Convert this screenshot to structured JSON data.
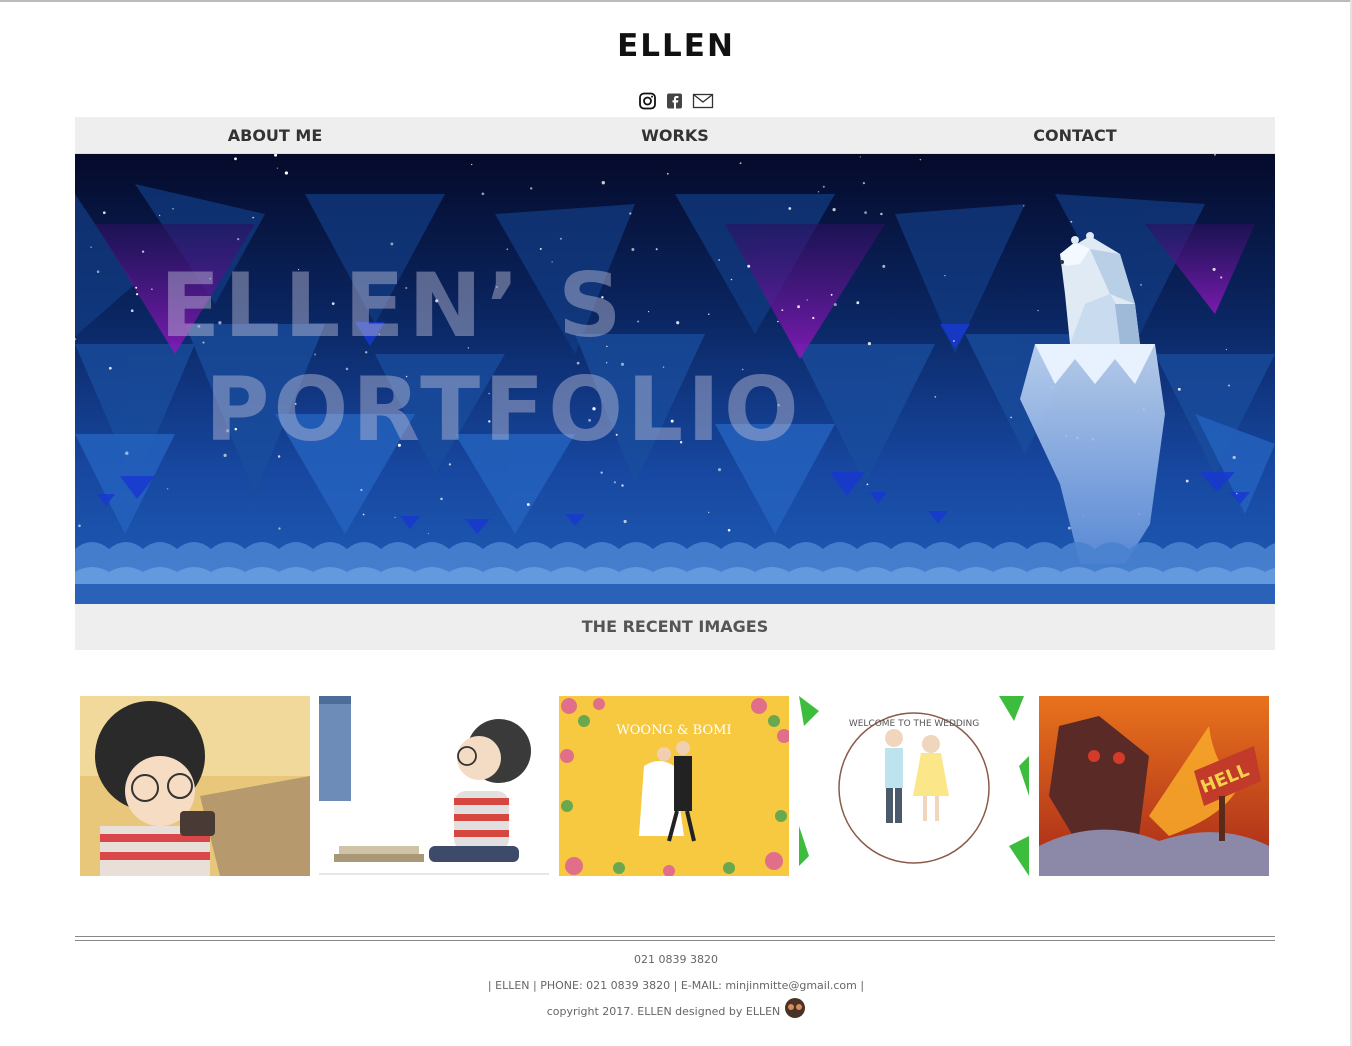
{
  "header": {
    "title": "ELLEN",
    "social_icons": [
      "instagram-icon",
      "facebook-icon",
      "mail-icon"
    ]
  },
  "nav": {
    "items": [
      {
        "label": "ABOUT ME"
      },
      {
        "label": "WORKS"
      },
      {
        "label": "CONTACT"
      }
    ]
  },
  "hero": {
    "line1": "ELLEN’ S",
    "line2": "PORTFOLIO"
  },
  "recent": {
    "title": "THE RECENT IMAGES",
    "images": [
      {
        "name": "curly-boy-camera-illustration"
      },
      {
        "name": "curly-boy-reading-illustration"
      },
      {
        "name": "wedding-invitation-yellow",
        "text": "WOONG & BOMI"
      },
      {
        "name": "wedding-circle-illustration",
        "text": "WELCOME TO THE WEDDING"
      },
      {
        "name": "hell-fire-illustration",
        "text": "HELL"
      }
    ]
  },
  "footer": {
    "phone": "021 0839 3820",
    "contact_line": "| ELLEN | PHONE: 021 0839 3820 | E-MAIL: minjinmitte@gmail.com |",
    "copyright": "copyright 2017. ELLEN designed by ELLEN"
  },
  "colors": {
    "nav_bg": "#eeeeee",
    "hero_top": "#050a2a",
    "hero_bottom": "#1f5fb8",
    "accent_purple": "#7a1aa8"
  }
}
